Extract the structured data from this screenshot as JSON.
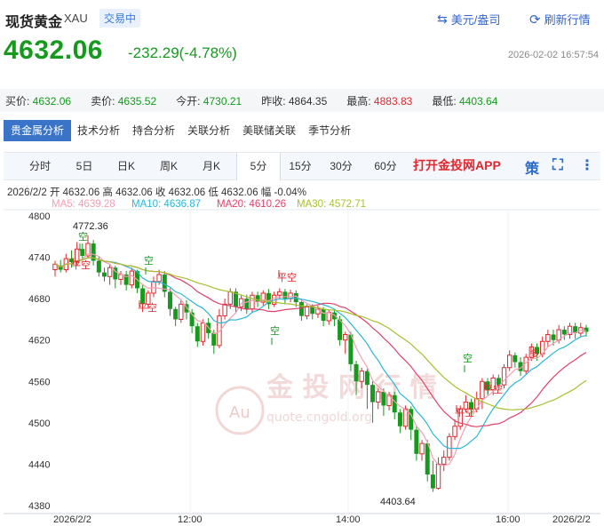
{
  "header": {
    "title": "现货黄金",
    "code": "XAU",
    "status_badge": "交易中",
    "currency_toggle": "美元/盎司",
    "refresh": "刷新行情",
    "price": "4632.06",
    "change": "-232.29(-4.78%)",
    "timestamp": "2026-02-02 16:57:54"
  },
  "stats": [
    {
      "label": "买价:",
      "value": "4632.06",
      "color": "#159a1d"
    },
    {
      "label": "卖价:",
      "value": "4635.52",
      "color": "#159a1d"
    },
    {
      "label": "今开:",
      "value": "4730.21",
      "color": "#159a1d"
    },
    {
      "label": "昨收:",
      "value": "4864.35",
      "color": "#333333"
    },
    {
      "label": "最高:",
      "value": "4883.83",
      "color": "#e0282e"
    },
    {
      "label": "最低:",
      "value": "4403.64",
      "color": "#159a1d"
    }
  ],
  "analysis_tabs": [
    "贵金属分析",
    "技术分析",
    "持合分析",
    "关联分析",
    "美联储关联",
    "季节分析"
  ],
  "period_tabs": [
    "分时",
    "5日",
    "日K",
    "周K",
    "月K",
    "5分",
    "15分",
    "30分",
    "60分"
  ],
  "active_period": "5分",
  "promo_text": "打开金投网APP",
  "toolbar_icons": {
    "strategy": "策",
    "fullscreen": "⛶",
    "more": "⋮"
  },
  "ohlc_line": "2026/2/2  开 4632.06  高 4632.06  收 4632.06  低 4632.06  幅 -0.04%",
  "ma_legend": [
    {
      "label": "MA5: 4639.28",
      "color": "#f0a0b4"
    },
    {
      "label": "MA10: 4636.87",
      "color": "#2bb6d8"
    },
    {
      "label": "MA20: 4610.26",
      "color": "#e0426a"
    },
    {
      "label": "MA30: 4572.71",
      "color": "#a8c030"
    }
  ],
  "watermark": {
    "text": "金 投 网 行 情",
    "url": "quote.cngold.org",
    "logo": "Au"
  },
  "chart_data": {
    "type": "candlestick",
    "y_ticks": [
      4800,
      4740,
      4680,
      4620,
      4560,
      4500,
      4440,
      4380
    ],
    "ylim": [
      4380,
      4815
    ],
    "x_ticks": [
      "2026/2/2",
      "12:00",
      "14:00",
      "16:00",
      "2026/2/2"
    ],
    "annotations": {
      "high": "4772.36",
      "low": "4403.64"
    },
    "signals": [
      "平空",
      "空",
      "空",
      "平空",
      "平空",
      "空",
      "空",
      "平空",
      "平空",
      "多"
    ],
    "candles": [
      [
        4722,
        4730,
        4712,
        4735
      ],
      [
        4728,
        4722,
        4718,
        4736
      ],
      [
        4722,
        4738,
        4718,
        4745
      ],
      [
        4738,
        4733,
        4725,
        4750
      ],
      [
        4733,
        4752,
        4728,
        4762
      ],
      [
        4752,
        4742,
        4735,
        4760
      ],
      [
        4742,
        4760,
        4738,
        4772
      ],
      [
        4760,
        4735,
        4728,
        4765
      ],
      [
        4735,
        4718,
        4712,
        4742
      ],
      [
        4718,
        4712,
        4705,
        4725
      ],
      [
        4712,
        4725,
        4700,
        4730
      ],
      [
        4725,
        4708,
        4695,
        4728
      ],
      [
        4708,
        4715,
        4700,
        4720
      ],
      [
        4715,
        4700,
        4692,
        4720
      ],
      [
        4700,
        4720,
        4695,
        4725
      ],
      [
        4720,
        4695,
        4688,
        4722
      ],
      [
        4695,
        4672,
        4665,
        4700
      ],
      [
        4672,
        4688,
        4665,
        4692
      ],
      [
        4688,
        4705,
        4682,
        4712
      ],
      [
        4705,
        4715,
        4700,
        4722
      ],
      [
        4715,
        4690,
        4682,
        4720
      ],
      [
        4690,
        4665,
        4655,
        4695
      ],
      [
        4665,
        4650,
        4640,
        4668
      ],
      [
        4650,
        4672,
        4645,
        4678
      ],
      [
        4672,
        4660,
        4650,
        4678
      ],
      [
        4660,
        4640,
        4630,
        4665
      ],
      [
        4640,
        4618,
        4610,
        4645
      ],
      [
        4618,
        4645,
        4612,
        4650
      ],
      [
        4645,
        4630,
        4622,
        4652
      ],
      [
        4630,
        4612,
        4600,
        4635
      ],
      [
        4612,
        4655,
        4608,
        4665
      ],
      [
        4655,
        4672,
        4650,
        4680
      ],
      [
        4672,
        4690,
        4665,
        4695
      ],
      [
        4690,
        4668,
        4660,
        4695
      ],
      [
        4668,
        4680,
        4662,
        4685
      ],
      [
        4680,
        4665,
        4658,
        4686
      ],
      [
        4665,
        4685,
        4660,
        4690
      ],
      [
        4685,
        4675,
        4668,
        4690
      ],
      [
        4675,
        4688,
        4670,
        4692
      ],
      [
        4688,
        4672,
        4665,
        4694
      ],
      [
        4672,
        4685,
        4668,
        4690
      ],
      [
        4685,
        4690,
        4680,
        4695
      ],
      [
        4690,
        4680,
        4672,
        4694
      ],
      [
        4680,
        4688,
        4675,
        4693
      ],
      [
        4688,
        4675,
        4668,
        4692
      ],
      [
        4675,
        4655,
        4648,
        4680
      ],
      [
        4655,
        4668,
        4650,
        4672
      ],
      [
        4668,
        4658,
        4650,
        4672
      ],
      [
        4658,
        4665,
        4652,
        4670
      ],
      [
        4665,
        4648,
        4640,
        4668
      ],
      [
        4648,
        4660,
        4642,
        4664
      ],
      [
        4660,
        4650,
        4640,
        4665
      ],
      [
        4650,
        4620,
        4612,
        4655
      ],
      [
        4620,
        4628,
        4600,
        4632
      ],
      [
        4628,
        4585,
        4575,
        4632
      ],
      [
        4585,
        4560,
        4540,
        4590
      ],
      [
        4560,
        4575,
        4550,
        4580
      ],
      [
        4575,
        4555,
        4520,
        4578
      ],
      [
        4555,
        4530,
        4500,
        4560
      ],
      [
        4530,
        4545,
        4520,
        4550
      ],
      [
        4545,
        4525,
        4510,
        4550
      ],
      [
        4525,
        4540,
        4518,
        4545
      ],
      [
        4540,
        4515,
        4505,
        4545
      ],
      [
        4515,
        4495,
        4485,
        4520
      ],
      [
        4495,
        4520,
        4490,
        4525
      ],
      [
        4520,
        4490,
        4475,
        4524
      ],
      [
        4490,
        4455,
        4445,
        4495
      ],
      [
        4455,
        4470,
        4445,
        4475
      ],
      [
        4470,
        4425,
        4415,
        4475
      ],
      [
        4425,
        4405,
        4400,
        4445
      ],
      [
        4405,
        4440,
        4403,
        4450
      ],
      [
        4440,
        4450,
        4430,
        4460
      ],
      [
        4450,
        4480,
        4445,
        4485
      ],
      [
        4480,
        4495,
        4475,
        4505
      ],
      [
        4495,
        4520,
        4490,
        4525
      ],
      [
        4520,
        4530,
        4515,
        4540
      ],
      [
        4530,
        4520,
        4510,
        4535
      ],
      [
        4520,
        4535,
        4515,
        4545
      ],
      [
        4535,
        4560,
        4520,
        4565
      ],
      [
        4560,
        4548,
        4540,
        4565
      ],
      [
        4548,
        4565,
        4540,
        4570
      ],
      [
        4565,
        4555,
        4548,
        4570
      ],
      [
        4555,
        4580,
        4550,
        4585
      ],
      [
        4580,
        4598,
        4575,
        4605
      ],
      [
        4598,
        4588,
        4580,
        4602
      ],
      [
        4588,
        4575,
        4568,
        4595
      ],
      [
        4575,
        4595,
        4570,
        4600
      ],
      [
        4595,
        4610,
        4590,
        4615
      ],
      [
        4610,
        4600,
        4590,
        4615
      ],
      [
        4600,
        4618,
        4595,
        4625
      ],
      [
        4618,
        4628,
        4610,
        4635
      ],
      [
        4628,
        4620,
        4612,
        4635
      ],
      [
        4620,
        4635,
        4615,
        4642
      ],
      [
        4635,
        4628,
        4620,
        4640
      ],
      [
        4628,
        4640,
        4622,
        4645
      ],
      [
        4640,
        4630,
        4622,
        4645
      ],
      [
        4630,
        4638,
        4625,
        4645
      ],
      [
        4638,
        4632,
        4625,
        4642
      ]
    ]
  }
}
